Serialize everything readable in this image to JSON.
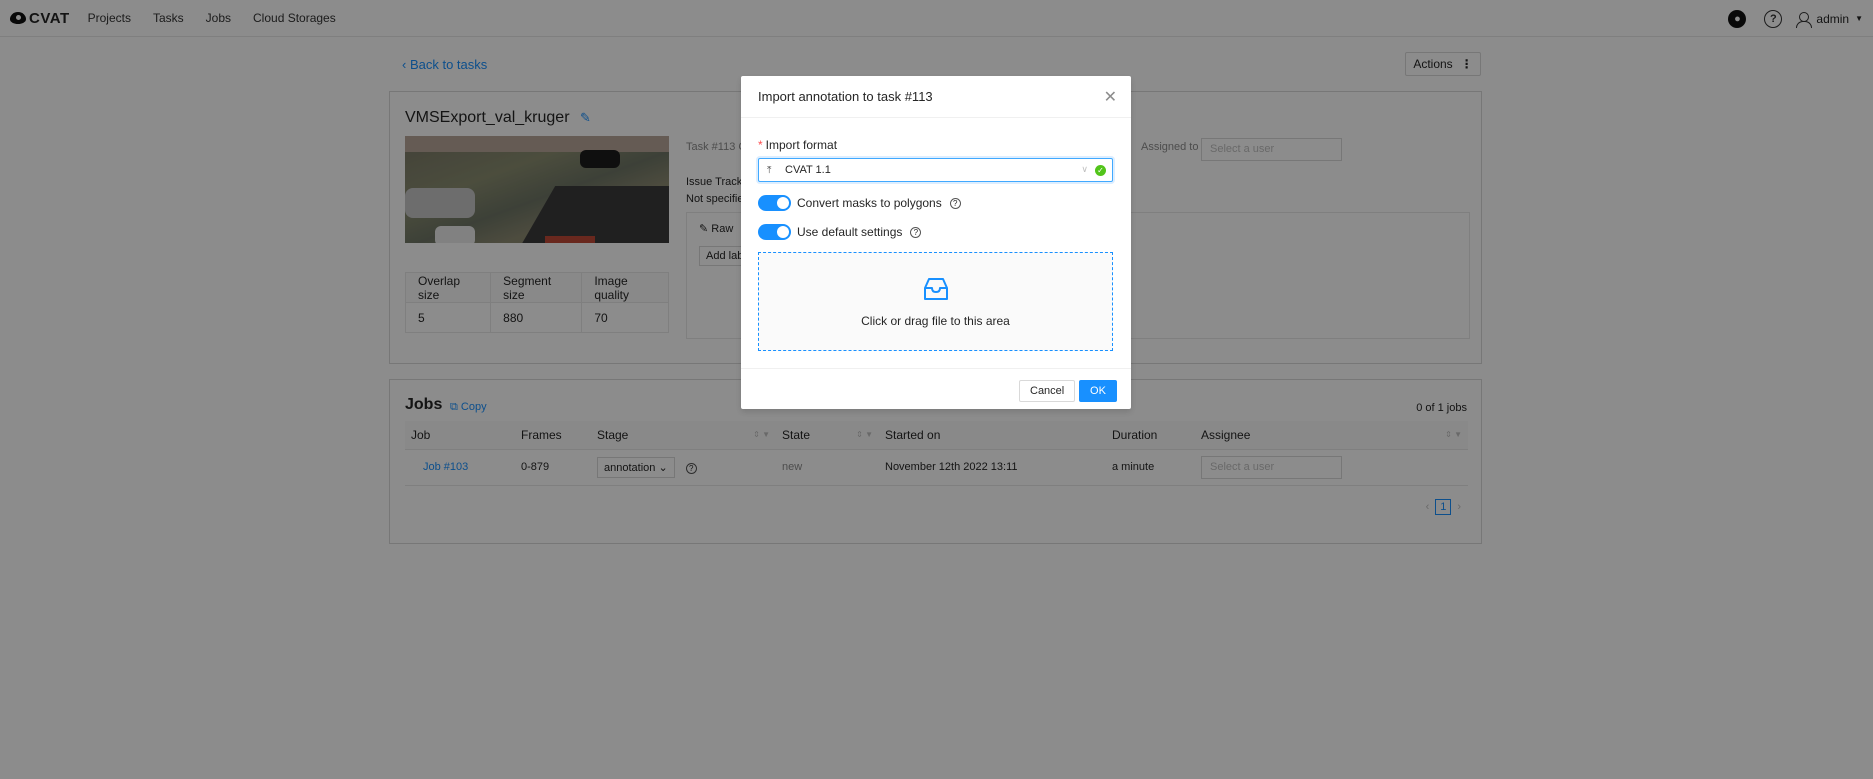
{
  "app": {
    "logo_text": "CVAT"
  },
  "nav": {
    "projects": "Projects",
    "tasks": "Tasks",
    "jobs": "Jobs",
    "cloud": "Cloud Storages"
  },
  "header_right": {
    "user": "admin"
  },
  "page": {
    "back_label": "Back to tasks",
    "actions_label": "Actions",
    "task_title": "VMSExport_val_kruger",
    "task_meta_fragment": "Task #113 C",
    "issue_fragment": "Issue Tracke",
    "notspec_fragment": "Not specifie",
    "raw_fragment": "Raw",
    "add_label_fragment": "Add lab",
    "assigned_label": "Assigned to",
    "assigned_placeholder": "Select a user",
    "specs": {
      "headers": [
        "Overlap size",
        "Segment size",
        "Image quality"
      ],
      "values": [
        "5",
        "880",
        "70"
      ]
    }
  },
  "jobs": {
    "title": "Jobs",
    "copy_label": "Copy",
    "count": "0 of 1 jobs",
    "columns": [
      "Job",
      "Frames",
      "Stage",
      "State",
      "Started on",
      "Duration",
      "Assignee"
    ],
    "rows": [
      {
        "job": "Job #103",
        "frames": "0-879",
        "stage": "annotation",
        "state": "new",
        "started": "November 12th 2022 13:11",
        "duration": "a minute",
        "assignee_placeholder": "Select a user"
      }
    ],
    "page": "1"
  },
  "modal": {
    "title": "Import annotation to task #113",
    "format_label": "Import format",
    "format_value": "CVAT 1.1",
    "convert_masks_label": "Convert masks to polygons",
    "convert_masks_on": true,
    "default_settings_label": "Use default settings",
    "default_settings_on": true,
    "drop_text": "Click or drag file to this area",
    "cancel_label": "Cancel",
    "ok_label": "OK"
  },
  "colors": {
    "accent": "#1890ff",
    "success": "#52c41a",
    "required": "#ff4d4f"
  }
}
